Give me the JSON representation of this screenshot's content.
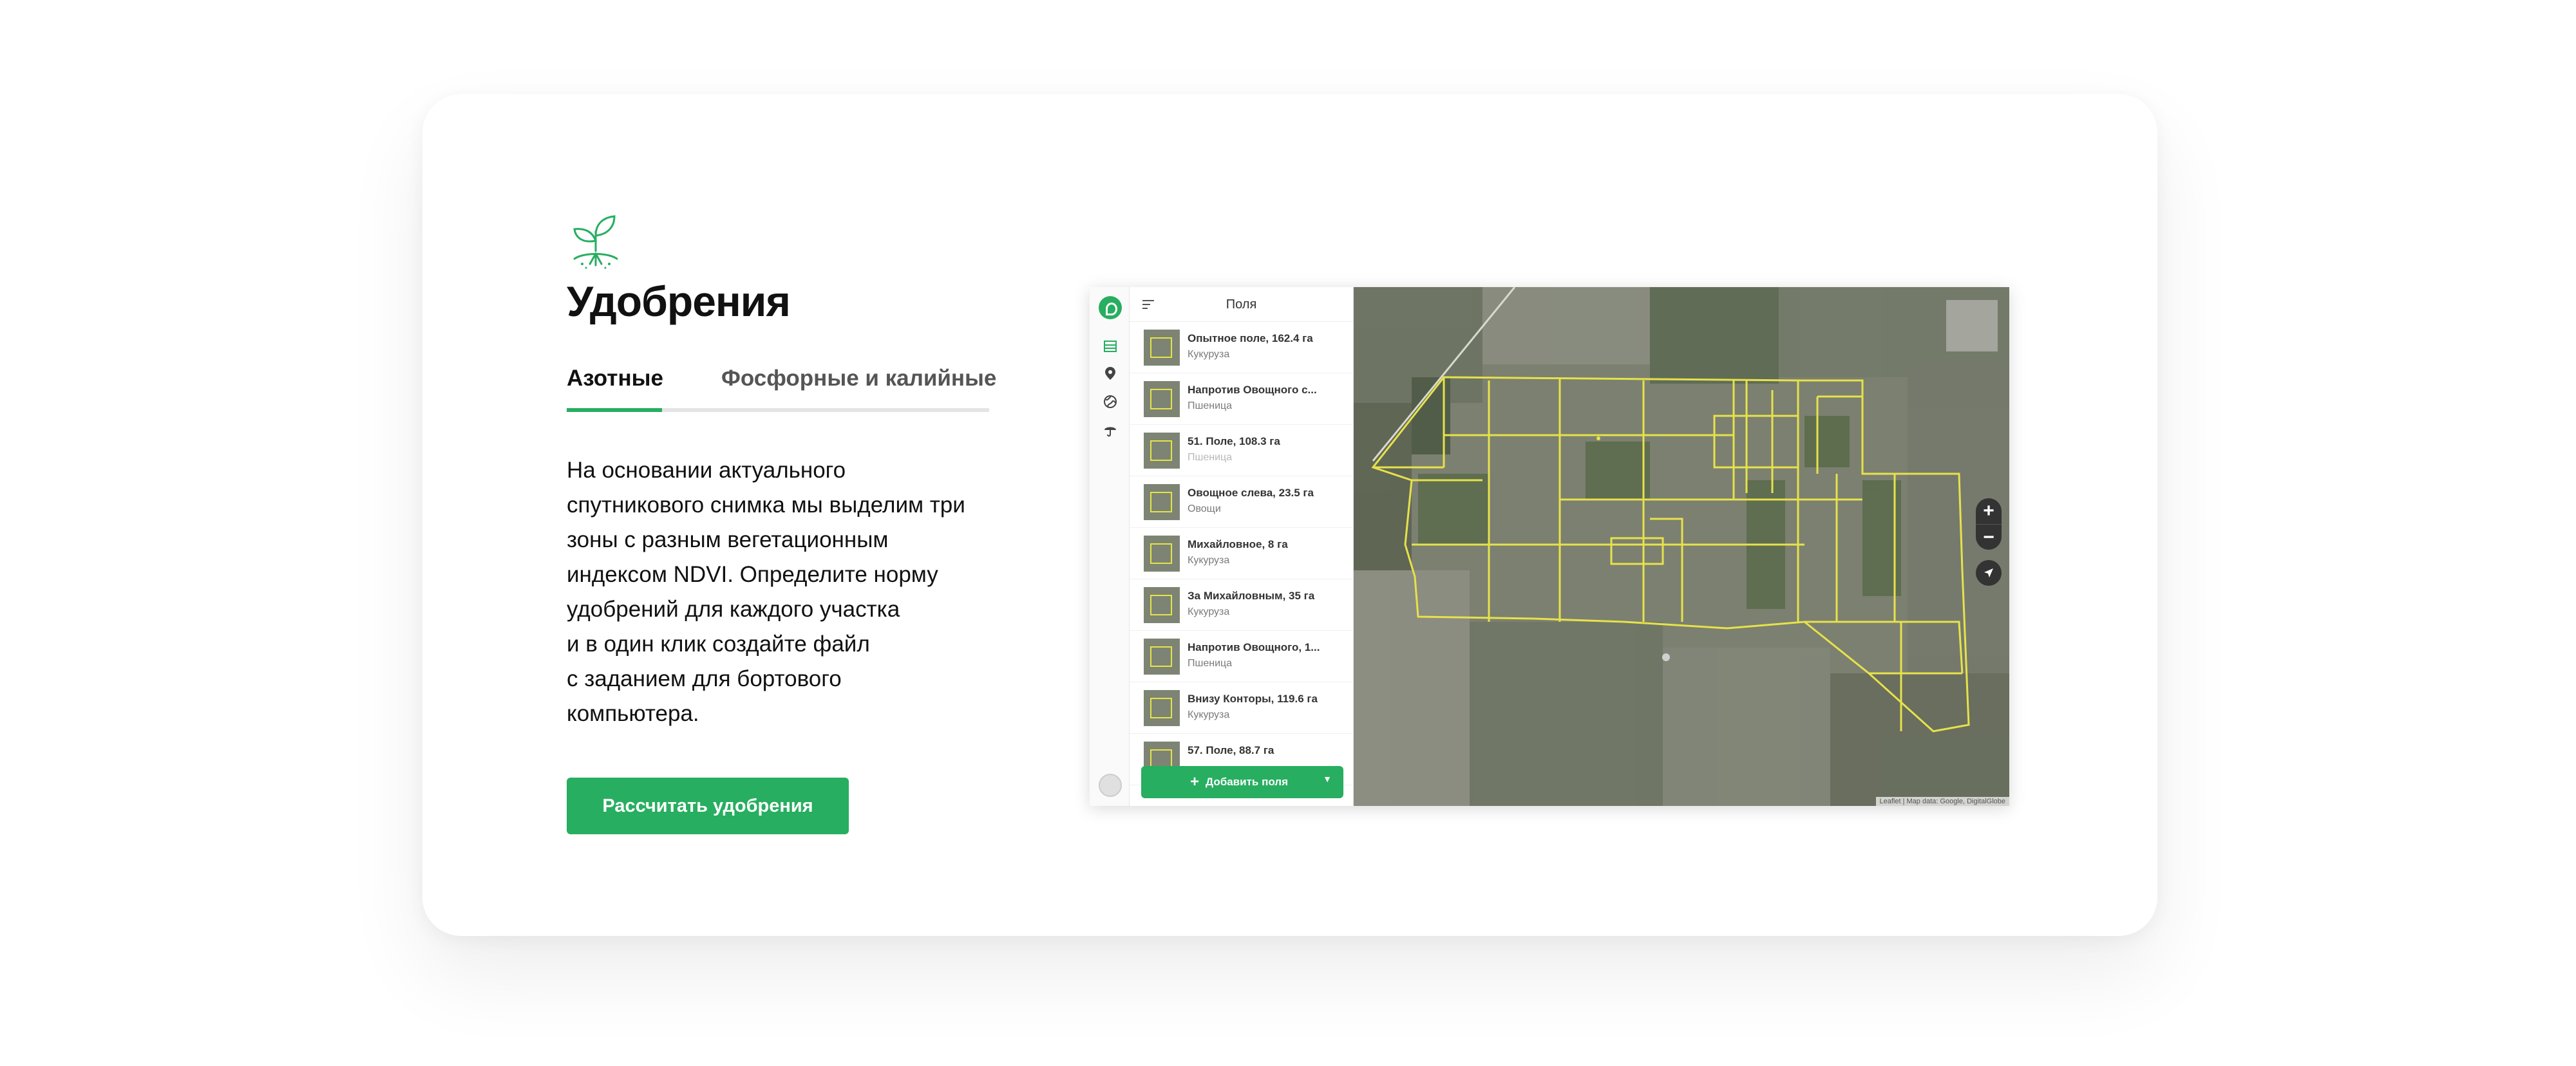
{
  "page": {
    "title": "Удобрения",
    "tabs": [
      "Азотные",
      "Фосфорные и калийные"
    ],
    "description_lines": [
      "На основании актуального",
      "спутникового снимка мы выделим три",
      "зоны с разным вегетационным",
      "индексом NDVI. Определите норму",
      "удобрений для каждого участка",
      "и в один клик создайте файл",
      "с заданием для бортового",
      "компьютера."
    ],
    "cta_label": "Рассчитать удобрения"
  },
  "app": {
    "panel_title": "Поля",
    "fields": [
      {
        "name": "Опытное поле, 162.4 га",
        "crop": "Кукуруза"
      },
      {
        "name": "Напротив Овощного с...",
        "crop": "Пшеница"
      },
      {
        "name": "51. Поле, 108.3 га",
        "crop": "Пшеница"
      },
      {
        "name": "Овощное слева, 23.5 га",
        "crop": "Овощи"
      },
      {
        "name": "Михайловное, 8 га",
        "crop": "Кукуруза"
      },
      {
        "name": "За Михайловным, 35 га",
        "crop": "Кукуруза"
      },
      {
        "name": "Напротив Овощного, 1...",
        "crop": "Пшеница"
      },
      {
        "name": "Внизу Конторы, 119.6 га",
        "crop": "Кукуруза"
      },
      {
        "name": "57. Поле, 88.7 га",
        "crop": ""
      }
    ],
    "add_fields_label": "Добавить поля",
    "zoom_in_label": "+",
    "zoom_out_label": "−",
    "attribution": "Leaflet | Map data: Google, DigitalGlobe"
  },
  "colors": {
    "accent": "#27ae60",
    "field_outline": "#e6e24a"
  },
  "icons": {
    "logo": "sprout-icon",
    "rail": [
      "fields-icon",
      "location-pin-icon",
      "globe-icon",
      "weather-icon"
    ]
  }
}
